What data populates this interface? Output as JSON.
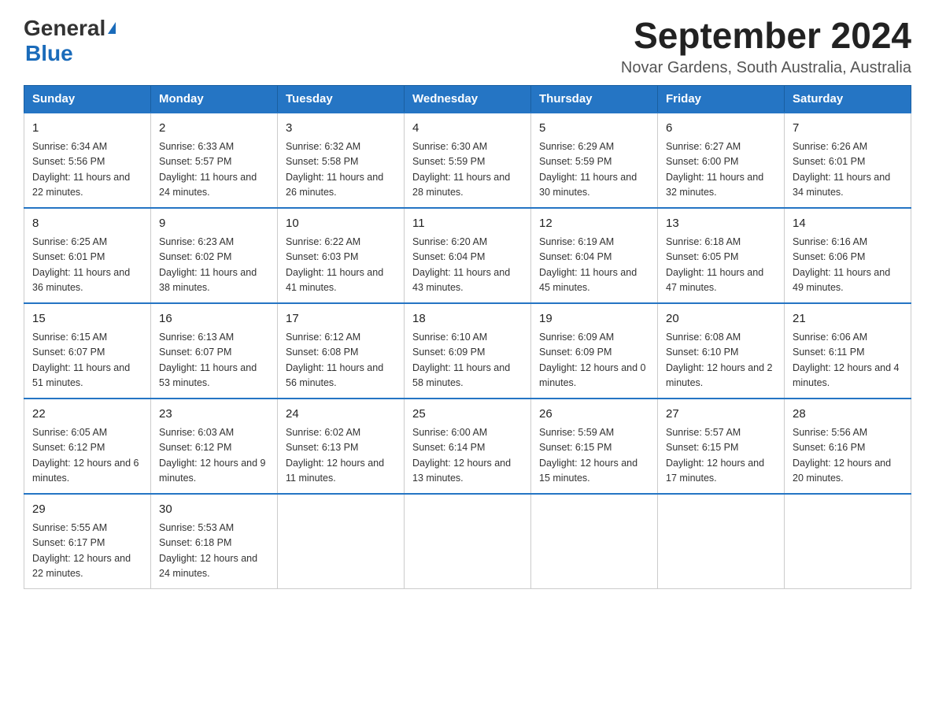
{
  "header": {
    "logo_general": "General",
    "logo_blue": "Blue",
    "title": "September 2024",
    "subtitle": "Novar Gardens, South Australia, Australia"
  },
  "columns": [
    "Sunday",
    "Monday",
    "Tuesday",
    "Wednesday",
    "Thursday",
    "Friday",
    "Saturday"
  ],
  "weeks": [
    [
      {
        "day": "1",
        "sunrise": "Sunrise: 6:34 AM",
        "sunset": "Sunset: 5:56 PM",
        "daylight": "Daylight: 11 hours and 22 minutes."
      },
      {
        "day": "2",
        "sunrise": "Sunrise: 6:33 AM",
        "sunset": "Sunset: 5:57 PM",
        "daylight": "Daylight: 11 hours and 24 minutes."
      },
      {
        "day": "3",
        "sunrise": "Sunrise: 6:32 AM",
        "sunset": "Sunset: 5:58 PM",
        "daylight": "Daylight: 11 hours and 26 minutes."
      },
      {
        "day": "4",
        "sunrise": "Sunrise: 6:30 AM",
        "sunset": "Sunset: 5:59 PM",
        "daylight": "Daylight: 11 hours and 28 minutes."
      },
      {
        "day": "5",
        "sunrise": "Sunrise: 6:29 AM",
        "sunset": "Sunset: 5:59 PM",
        "daylight": "Daylight: 11 hours and 30 minutes."
      },
      {
        "day": "6",
        "sunrise": "Sunrise: 6:27 AM",
        "sunset": "Sunset: 6:00 PM",
        "daylight": "Daylight: 11 hours and 32 minutes."
      },
      {
        "day": "7",
        "sunrise": "Sunrise: 6:26 AM",
        "sunset": "Sunset: 6:01 PM",
        "daylight": "Daylight: 11 hours and 34 minutes."
      }
    ],
    [
      {
        "day": "8",
        "sunrise": "Sunrise: 6:25 AM",
        "sunset": "Sunset: 6:01 PM",
        "daylight": "Daylight: 11 hours and 36 minutes."
      },
      {
        "day": "9",
        "sunrise": "Sunrise: 6:23 AM",
        "sunset": "Sunset: 6:02 PM",
        "daylight": "Daylight: 11 hours and 38 minutes."
      },
      {
        "day": "10",
        "sunrise": "Sunrise: 6:22 AM",
        "sunset": "Sunset: 6:03 PM",
        "daylight": "Daylight: 11 hours and 41 minutes."
      },
      {
        "day": "11",
        "sunrise": "Sunrise: 6:20 AM",
        "sunset": "Sunset: 6:04 PM",
        "daylight": "Daylight: 11 hours and 43 minutes."
      },
      {
        "day": "12",
        "sunrise": "Sunrise: 6:19 AM",
        "sunset": "Sunset: 6:04 PM",
        "daylight": "Daylight: 11 hours and 45 minutes."
      },
      {
        "day": "13",
        "sunrise": "Sunrise: 6:18 AM",
        "sunset": "Sunset: 6:05 PM",
        "daylight": "Daylight: 11 hours and 47 minutes."
      },
      {
        "day": "14",
        "sunrise": "Sunrise: 6:16 AM",
        "sunset": "Sunset: 6:06 PM",
        "daylight": "Daylight: 11 hours and 49 minutes."
      }
    ],
    [
      {
        "day": "15",
        "sunrise": "Sunrise: 6:15 AM",
        "sunset": "Sunset: 6:07 PM",
        "daylight": "Daylight: 11 hours and 51 minutes."
      },
      {
        "day": "16",
        "sunrise": "Sunrise: 6:13 AM",
        "sunset": "Sunset: 6:07 PM",
        "daylight": "Daylight: 11 hours and 53 minutes."
      },
      {
        "day": "17",
        "sunrise": "Sunrise: 6:12 AM",
        "sunset": "Sunset: 6:08 PM",
        "daylight": "Daylight: 11 hours and 56 minutes."
      },
      {
        "day": "18",
        "sunrise": "Sunrise: 6:10 AM",
        "sunset": "Sunset: 6:09 PM",
        "daylight": "Daylight: 11 hours and 58 minutes."
      },
      {
        "day": "19",
        "sunrise": "Sunrise: 6:09 AM",
        "sunset": "Sunset: 6:09 PM",
        "daylight": "Daylight: 12 hours and 0 minutes."
      },
      {
        "day": "20",
        "sunrise": "Sunrise: 6:08 AM",
        "sunset": "Sunset: 6:10 PM",
        "daylight": "Daylight: 12 hours and 2 minutes."
      },
      {
        "day": "21",
        "sunrise": "Sunrise: 6:06 AM",
        "sunset": "Sunset: 6:11 PM",
        "daylight": "Daylight: 12 hours and 4 minutes."
      }
    ],
    [
      {
        "day": "22",
        "sunrise": "Sunrise: 6:05 AM",
        "sunset": "Sunset: 6:12 PM",
        "daylight": "Daylight: 12 hours and 6 minutes."
      },
      {
        "day": "23",
        "sunrise": "Sunrise: 6:03 AM",
        "sunset": "Sunset: 6:12 PM",
        "daylight": "Daylight: 12 hours and 9 minutes."
      },
      {
        "day": "24",
        "sunrise": "Sunrise: 6:02 AM",
        "sunset": "Sunset: 6:13 PM",
        "daylight": "Daylight: 12 hours and 11 minutes."
      },
      {
        "day": "25",
        "sunrise": "Sunrise: 6:00 AM",
        "sunset": "Sunset: 6:14 PM",
        "daylight": "Daylight: 12 hours and 13 minutes."
      },
      {
        "day": "26",
        "sunrise": "Sunrise: 5:59 AM",
        "sunset": "Sunset: 6:15 PM",
        "daylight": "Daylight: 12 hours and 15 minutes."
      },
      {
        "day": "27",
        "sunrise": "Sunrise: 5:57 AM",
        "sunset": "Sunset: 6:15 PM",
        "daylight": "Daylight: 12 hours and 17 minutes."
      },
      {
        "day": "28",
        "sunrise": "Sunrise: 5:56 AM",
        "sunset": "Sunset: 6:16 PM",
        "daylight": "Daylight: 12 hours and 20 minutes."
      }
    ],
    [
      {
        "day": "29",
        "sunrise": "Sunrise: 5:55 AM",
        "sunset": "Sunset: 6:17 PM",
        "daylight": "Daylight: 12 hours and 22 minutes."
      },
      {
        "day": "30",
        "sunrise": "Sunrise: 5:53 AM",
        "sunset": "Sunset: 6:18 PM",
        "daylight": "Daylight: 12 hours and 24 minutes."
      },
      null,
      null,
      null,
      null,
      null
    ]
  ]
}
